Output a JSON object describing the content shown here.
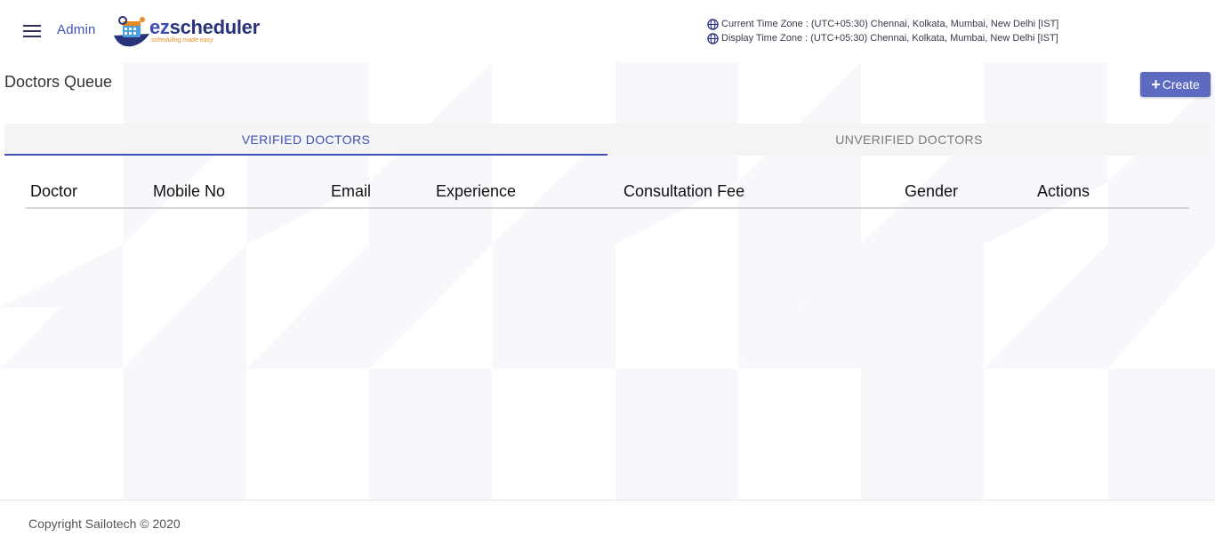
{
  "header": {
    "admin_label": "Admin",
    "logo": {
      "brand_prefix": "ez",
      "brand_rest": "scheduler",
      "tagline": "scheduling made easy"
    },
    "timezones": {
      "current": "Current Time Zone : (UTC+05:30) Chennai, Kolkata, Mumbai, New Delhi [IST]",
      "display": "Display Time Zone : (UTC+05:30) Chennai, Kolkata, Mumbai, New Delhi [IST]"
    }
  },
  "main": {
    "title": "Doctors Queue",
    "create_label": "Create",
    "tabs": [
      {
        "label": "VERIFIED DOCTORS",
        "active": true
      },
      {
        "label": "UNVERIFIED DOCTORS",
        "active": false
      }
    ],
    "table": {
      "columns": [
        "Doctor",
        "Mobile No",
        "Email",
        "Experience",
        "Consultation Fee",
        "Gender",
        "Actions"
      ],
      "rows": []
    }
  },
  "footer": {
    "copyright": "Copyright Sailotech © 2020"
  },
  "colors": {
    "accent": "#3f51b5",
    "button": "#5c6bc0",
    "logo_orange": "#e88b20",
    "logo_navy": "#28337a"
  }
}
